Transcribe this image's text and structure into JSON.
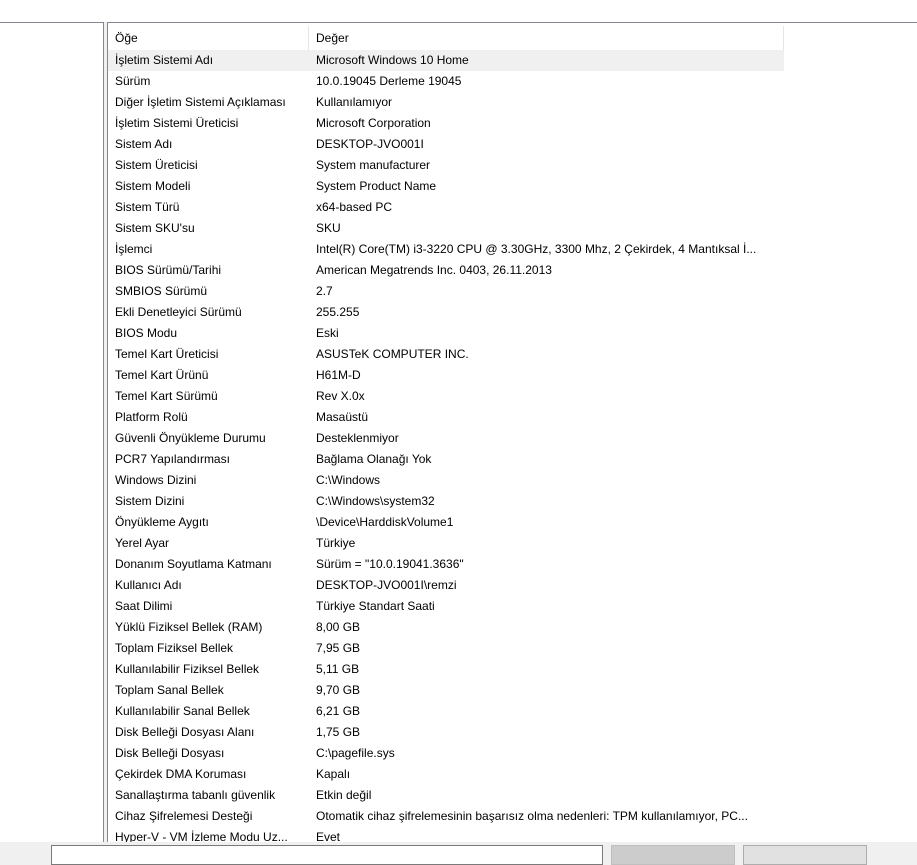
{
  "header": {
    "item_label": "Öğe",
    "value_label": "Değer"
  },
  "rows": [
    {
      "item": "İşletim Sistemi Adı",
      "value": "Microsoft Windows 10 Home"
    },
    {
      "item": "Sürüm",
      "value": "10.0.19045 Derleme 19045"
    },
    {
      "item": "Diğer İşletim Sistemi Açıklaması",
      "value": "Kullanılamıyor"
    },
    {
      "item": "İşletim Sistemi Üreticisi",
      "value": "Microsoft Corporation"
    },
    {
      "item": "Sistem Adı",
      "value": "DESKTOP-JVO001I"
    },
    {
      "item": "Sistem Üreticisi",
      "value": "System manufacturer"
    },
    {
      "item": "Sistem Modeli",
      "value": "System Product Name"
    },
    {
      "item": "Sistem Türü",
      "value": "x64-based PC"
    },
    {
      "item": "Sistem SKU'su",
      "value": "SKU"
    },
    {
      "item": "İşlemci",
      "value": "Intel(R) Core(TM) i3-3220 CPU @ 3.30GHz, 3300 Mhz, 2 Çekirdek, 4 Mantıksal İ..."
    },
    {
      "item": "BIOS Sürümü/Tarihi",
      "value": "American Megatrends Inc. 0403, 26.11.2013"
    },
    {
      "item": "SMBIOS Sürümü",
      "value": "2.7"
    },
    {
      "item": "Ekli Denetleyici Sürümü",
      "value": "255.255"
    },
    {
      "item": "BIOS Modu",
      "value": "Eski"
    },
    {
      "item": "Temel Kart Üreticisi",
      "value": "ASUSTeK COMPUTER INC."
    },
    {
      "item": "Temel Kart Ürünü",
      "value": "H61M-D"
    },
    {
      "item": "Temel Kart Sürümü",
      "value": "Rev X.0x"
    },
    {
      "item": "Platform Rolü",
      "value": "Masaüstü"
    },
    {
      "item": "Güvenli Önyükleme Durumu",
      "value": "Desteklenmiyor"
    },
    {
      "item": "PCR7 Yapılandırması",
      "value": "Bağlama Olanağı Yok"
    },
    {
      "item": "Windows Dizini",
      "value": "C:\\Windows"
    },
    {
      "item": "Sistem Dizini",
      "value": "C:\\Windows\\system32"
    },
    {
      "item": "Önyükleme Aygıtı",
      "value": "\\Device\\HarddiskVolume1"
    },
    {
      "item": "Yerel Ayar",
      "value": "Türkiye"
    },
    {
      "item": "Donanım Soyutlama Katmanı",
      "value": "Sürüm = \"10.0.19041.3636\""
    },
    {
      "item": "Kullanıcı Adı",
      "value": "DESKTOP-JVO001I\\remzi"
    },
    {
      "item": "Saat Dilimi",
      "value": "Türkiye Standart Saati"
    },
    {
      "item": "Yüklü Fiziksel Bellek (RAM)",
      "value": "8,00 GB"
    },
    {
      "item": "Toplam Fiziksel Bellek",
      "value": "7,95 GB"
    },
    {
      "item": "Kullanılabilir Fiziksel Bellek",
      "value": "5,11 GB"
    },
    {
      "item": "Toplam Sanal Bellek",
      "value": "9,70 GB"
    },
    {
      "item": "Kullanılabilir Sanal Bellek",
      "value": "6,21 GB"
    },
    {
      "item": "Disk Belleği Dosyası Alanı",
      "value": "1,75 GB"
    },
    {
      "item": "Disk Belleği Dosyası",
      "value": "C:\\pagefile.sys"
    },
    {
      "item": "Çekirdek DMA Koruması",
      "value": "Kapalı"
    },
    {
      "item": "Sanallaştırma tabanlı güvenlik",
      "value": "Etkin değil"
    },
    {
      "item": "Cihaz Şifrelemesi Desteği",
      "value": "Otomatik cihaz şifrelemesinin başarısız olma nedenleri: TPM kullanılamıyor, PC..."
    },
    {
      "item": "Hyper-V - VM İzleme Modu Uz...",
      "value": "Evet"
    }
  ],
  "selected_row_index": 0,
  "colors": {
    "selected_row": "#f0f0f0",
    "border": "#828790",
    "window_bg": "#f0f0f0"
  }
}
